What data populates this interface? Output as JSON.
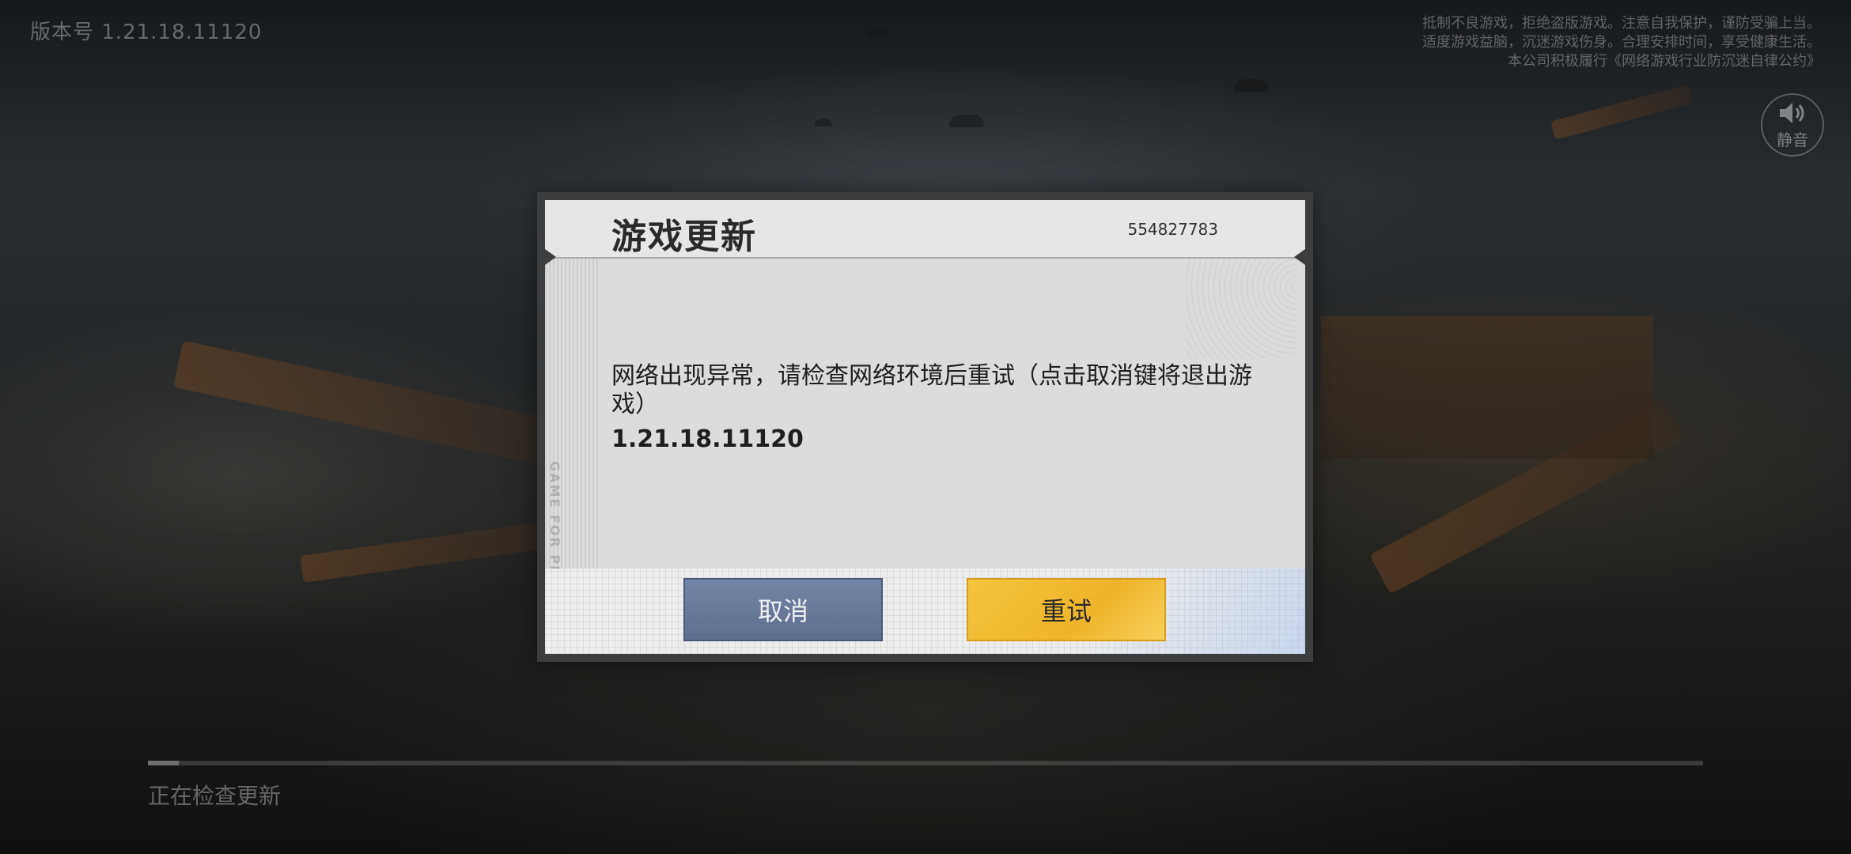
{
  "top_bar": {
    "version": "版本号  1.21.18.11120",
    "notice_line1": "抵制不良游戏，拒绝盗版游戏。注意自我保护，谨防受骗上当。",
    "notice_line2": "适度游戏益脑，沉迷游戏伤身。合理安排时间，享受健康生活。",
    "notice_line3": "本公司积极履行《网络游戏行业防沉迷自律公约》",
    "mute_label": "静音"
  },
  "dialog": {
    "title": "游戏更新",
    "id": "554827783",
    "side_text": "GAME FOR PEACE",
    "message": "网络出现异常，请检查网络环境后重试（点击取消键将退出游戏）",
    "version": "1.21.18.11120",
    "cancel_label": "取消",
    "retry_label": "重试"
  },
  "loading": {
    "status": "正在检查更新",
    "progress": 0.02
  },
  "colors": {
    "cancel_button": "#6677a0",
    "retry_button": "#f3bd33"
  },
  "icons": {
    "mute": "speaker-icon"
  }
}
